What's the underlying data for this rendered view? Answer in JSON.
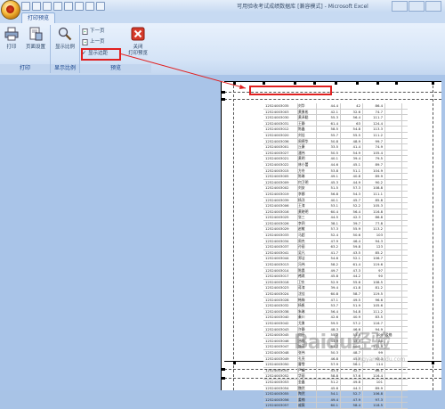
{
  "window": {
    "title": "可用验收考试成绩数据库 [兼容模式] - Microsoft Excel"
  },
  "tabs": [
    {
      "label": "打印预览"
    }
  ],
  "ribbon": {
    "groups": [
      {
        "label": "打印",
        "buttons": [
          {
            "label": "打印"
          },
          {
            "label": "页面设置"
          }
        ]
      },
      {
        "label": "显示比例",
        "buttons": [
          {
            "label": "显示比例"
          }
        ]
      },
      {
        "label": "预览",
        "buttons": [
          {
            "label": "下一页"
          },
          {
            "label": "上一页"
          },
          {
            "label": "显示边距"
          },
          {
            "label": "关闭\n打印预览"
          }
        ]
      }
    ],
    "show_margins_checked": true
  },
  "sheet": {
    "rows": [
      [
        "12524003035",
        "刘华",
        "44.4",
        "42",
        "86.4",
        ""
      ],
      [
        "12524003003",
        "黄勇彬",
        "42.1",
        "32.6",
        "74.7",
        ""
      ],
      [
        "12524003030",
        "黄泽聪",
        "55.3",
        "56.4",
        "111.7",
        ""
      ],
      [
        "12524003031",
        "王静",
        "61.4",
        "63",
        "124.4",
        ""
      ],
      [
        "12524003012",
        "陈鑫",
        "58.5",
        "54.8",
        "113.3",
        ""
      ],
      [
        "12524003020",
        "刘佳",
        "55.7",
        "55.5",
        "111.2",
        ""
      ],
      [
        "12524003036",
        "周德华",
        "50.8",
        "48.9",
        "99.7",
        ""
      ],
      [
        "12524003001",
        "丘康",
        "33.5",
        "41.4",
        "74.9",
        ""
      ],
      [
        "12524003027",
        "潘伟",
        "50.5",
        "54.9",
        "105.4",
        ""
      ],
      [
        "12524003021",
        "黄明",
        "40.1",
        "39.4",
        "79.5",
        ""
      ],
      [
        "12524003022",
        "林小蕾",
        "44.6",
        "45.1",
        "89.7",
        ""
      ],
      [
        "12524003015",
        "方舟",
        "53.8",
        "51.1",
        "104.9",
        ""
      ],
      [
        "12524003005",
        "陈琳",
        "49.1",
        "40.8",
        "89.9",
        ""
      ],
      [
        "12524003009",
        "何卫明",
        "45.3",
        "44.9",
        "90.2",
        ""
      ],
      [
        "12524003002",
        "刘安",
        "51.5",
        "57.3",
        "108.8",
        ""
      ],
      [
        "12524003019",
        "李娜",
        "56.8",
        "54.3",
        "111.1",
        ""
      ],
      [
        "12524003039",
        "杨洋",
        "40.1",
        "45.7",
        "85.8",
        ""
      ],
      [
        "12524003006",
        "王涛",
        "53.1",
        "52.2",
        "105.3",
        ""
      ],
      [
        "12524003016",
        "黄晓明",
        "60.4",
        "56.4",
        "116.8",
        ""
      ],
      [
        "12524003025",
        "张三",
        "44.5",
        "42.3",
        "86.8",
        ""
      ],
      [
        "12524003026",
        "李四",
        "38.1",
        "39.7",
        "77.8",
        ""
      ],
      [
        "12524003029",
        "赵敏",
        "57.3",
        "55.9",
        "113.2",
        ""
      ],
      [
        "12524003033",
        "马超",
        "52.4",
        "50.6",
        "103",
        ""
      ],
      [
        "12524003034",
        "周杰",
        "47.9",
        "46.4",
        "94.3",
        ""
      ],
      [
        "12524003037",
        "孙丽",
        "63.2",
        "59.8",
        "123",
        ""
      ],
      [
        "12524003041",
        "吴凡",
        "41.7",
        "43.5",
        "85.2",
        ""
      ],
      [
        "12524003044",
        "郑洁",
        "54.6",
        "52.1",
        "106.7",
        ""
      ],
      [
        "12524003013",
        "冯伟",
        "58.2",
        "61.4",
        "119.6",
        ""
      ],
      [
        "12524003014",
        "陈晨",
        "49.7",
        "47.3",
        "97",
        ""
      ],
      [
        "12524003017",
        "褚琪",
        "45.8",
        "44.2",
        "90",
        ""
      ],
      [
        "12524003018",
        "卫东",
        "52.9",
        "55.6",
        "108.5",
        ""
      ],
      [
        "12524003023",
        "蒋涛",
        "39.4",
        "41.8",
        "81.2",
        ""
      ],
      [
        "12524003024",
        "沈佳",
        "60.8",
        "58.7",
        "119.5",
        ""
      ],
      [
        "12524003028",
        "韩梅",
        "47.1",
        "49.5",
        "96.6",
        ""
      ],
      [
        "12524003032",
        "杨帆",
        "53.7",
        "51.9",
        "105.6",
        ""
      ],
      [
        "12524003038",
        "朱琳",
        "56.4",
        "54.8",
        "111.2",
        ""
      ],
      [
        "12524003040",
        "秦川",
        "42.6",
        "40.9",
        "83.5",
        ""
      ],
      [
        "12524003042",
        "尤勇",
        "59.5",
        "57.2",
        "116.7",
        ""
      ],
      [
        "12524003043",
        "许静",
        "48.3",
        "46.6",
        "94.9",
        ""
      ],
      [
        "12524003045",
        "何平",
        "55.2",
        "53.8",
        "109",
        "及格"
      ],
      [
        "12524003046",
        "吕强",
        "44.9",
        "43.1",
        "88",
        ""
      ],
      [
        "12524003047",
        "施芳",
        "61.7",
        "60.2",
        "121.9",
        ""
      ],
      [
        "12524003048",
        "张伟",
        "50.3",
        "48.7",
        "99",
        ""
      ],
      [
        "12524003049",
        "孔亮",
        "46.8",
        "45.5",
        "92.3",
        ""
      ],
      [
        "12524003050",
        "曹雪",
        "57.9",
        "56.1",
        "114",
        ""
      ],
      [
        "12524003051",
        "严峰",
        "43.4",
        "42.7",
        "86.1",
        ""
      ],
      [
        "12524003052",
        "华丽",
        "58.8",
        "57.6",
        "116.4",
        ""
      ],
      [
        "12524003053",
        "金鑫",
        "51.2",
        "49.8",
        "101",
        ""
      ],
      [
        "12524003054",
        "魏然",
        "45.6",
        "44.3",
        "89.9",
        ""
      ],
      [
        "12524003055",
        "陶然",
        "54.1",
        "52.7",
        "106.8",
        ""
      ],
      [
        "12524003056",
        "姜楠",
        "49.4",
        "47.9",
        "97.3",
        ""
      ],
      [
        "12524003057",
        "戚薇",
        "60.1",
        "58.4",
        "118.5",
        ""
      ]
    ]
  },
  "watermark": {
    "text": "Baidu经验",
    "sub": "jingyan.baidu.com"
  }
}
